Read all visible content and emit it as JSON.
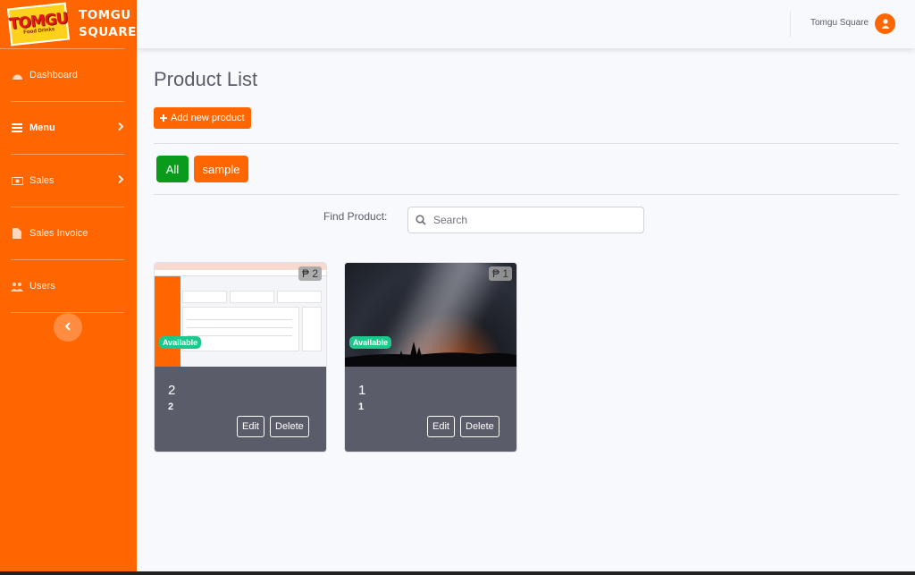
{
  "brand": {
    "logo_text": "TOMGU",
    "logo_sub": "Food Drinks",
    "line1": "TOMGU",
    "line2": "SQUARE"
  },
  "sidebar": {
    "items": [
      {
        "label": "Dashboard",
        "icon": "dashboard-icon"
      },
      {
        "label": "Menu",
        "icon": "list-icon",
        "has_chevron": true
      },
      {
        "label": "Sales",
        "icon": "money-icon",
        "has_chevron": true
      },
      {
        "label": "Sales Invoice",
        "icon": "file-icon"
      },
      {
        "label": "Users",
        "icon": "users-icon"
      }
    ]
  },
  "topbar": {
    "user_name": "Tomgu Square"
  },
  "main": {
    "title": "Product List",
    "add_button": "Add new product",
    "filters": {
      "all": "All",
      "sample": "sample"
    },
    "find_label": "Find Product:",
    "search_placeholder": "Search"
  },
  "products": [
    {
      "price": "₱ 2",
      "status": "Available",
      "name": "2",
      "description": "2",
      "edit": "Edit",
      "delete": "Delete"
    },
    {
      "price": "₱ 1",
      "status": "Available",
      "name": "1",
      "description": "1",
      "edit": "Edit",
      "delete": "Delete"
    }
  ],
  "colors": {
    "primary": "#ff6600",
    "success": "#0a9b1c",
    "available": "#1cc88a",
    "card_body": "#5a5c69"
  }
}
